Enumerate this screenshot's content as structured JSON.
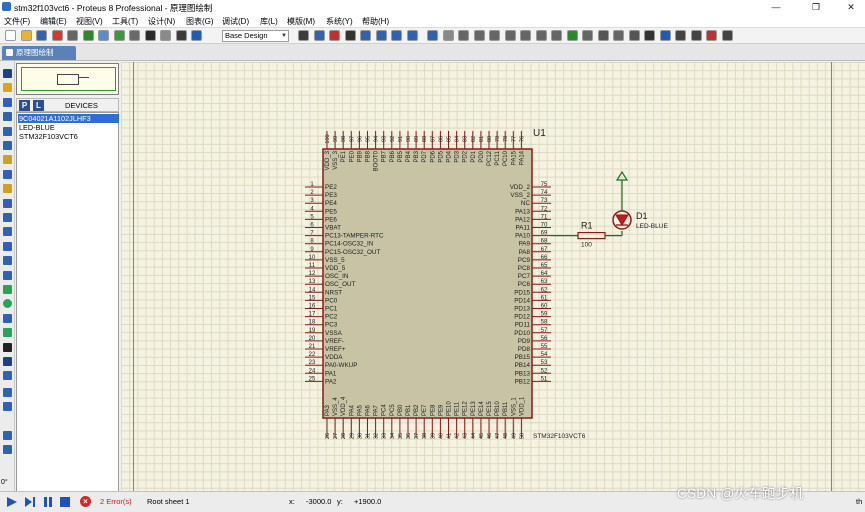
{
  "window": {
    "title": "stm32f103vct6 - Proteus 8 Professional - 原理图绘制",
    "minimize": "—",
    "maximize": "❐",
    "close": "✕"
  },
  "menu": [
    "文件(F)",
    "编辑(E)",
    "视图(V)",
    "工具(T)",
    "设计(N)",
    "图表(G)",
    "调试(D)",
    "库(L)",
    "模版(M)",
    "系统(Y)",
    "帮助(H)"
  ],
  "toolbar": {
    "design_select": "Base Design",
    "icons": [
      "new-icon",
      "open-icon",
      "save-icon",
      "import-icon",
      "close-icon",
      "home-icon",
      "schematic-icon",
      "pcb-icon",
      "gallery-icon",
      "bom-icon",
      "source-icon",
      "vsm-icon",
      "help-icon",
      "refresh-icon",
      "grid-icon",
      "origin-icon",
      "pan-icon",
      "zoom-in-icon",
      "zoom-out-icon",
      "zoom-all-icon",
      "zoom-area-icon",
      "undo-icon",
      "redo-icon",
      "cut-icon",
      "copy-icon",
      "paste-icon",
      "block-copy-icon",
      "block-move-icon",
      "block-rotate-icon",
      "block-delete-icon",
      "pick-device-icon",
      "make-device-icon",
      "packaging-icon",
      "decompose-icon",
      "wire-autorouter-icon",
      "search-icon",
      "property-tool-icon",
      "new-sheet-icon",
      "remove-sheet-icon",
      "exit-to-parent-icon",
      "annotate-icon"
    ]
  },
  "tab": {
    "label": "原理图绘制"
  },
  "side_tools": [
    "select-icon",
    "component-icon",
    "junction-icon",
    "wire-label-icon",
    "text-script-icon",
    "bus-icon",
    "subcircuit-icon",
    "terminal-icon",
    "device-pin-icon",
    "graph-icon",
    "recorder-icon",
    "generator-icon",
    "probe-icon",
    "instrument-icon",
    "line-icon",
    "box-icon",
    "circle-icon",
    "arc-icon",
    "path-icon",
    "text-icon",
    "symbol-icon",
    "marker-icon",
    "rotate-cw-icon",
    "rotate-ccw-icon",
    "flip-h-icon",
    "flip-v-icon"
  ],
  "rotation": "0°",
  "devices": {
    "p_button": "P",
    "l_button": "L",
    "header": "DEVICES",
    "items": [
      "9C04021A1102JLHF3",
      "LED-BLUE",
      "STM32F103VCT6"
    ],
    "selected_index": 0
  },
  "schematic": {
    "chip_ref": "U1",
    "chip_part": "STM32F103VCT6",
    "left_pins": [
      {
        "num": "1",
        "name": "PE2"
      },
      {
        "num": "2",
        "name": "PE3"
      },
      {
        "num": "3",
        "name": "PE4"
      },
      {
        "num": "4",
        "name": "PE5"
      },
      {
        "num": "5",
        "name": "PE6"
      },
      {
        "num": "6",
        "name": "VBAT"
      },
      {
        "num": "7",
        "name": "PC13-TAMPER-RTC"
      },
      {
        "num": "8",
        "name": "PC14-OSC32_IN"
      },
      {
        "num": "9",
        "name": "PC15-OSC32_OUT"
      },
      {
        "num": "10",
        "name": "VSS_5"
      },
      {
        "num": "11",
        "name": "VDD_5"
      },
      {
        "num": "12",
        "name": "OSC_IN"
      },
      {
        "num": "13",
        "name": "OSC_OUT"
      },
      {
        "num": "14",
        "name": "NRST"
      },
      {
        "num": "15",
        "name": "PC0"
      },
      {
        "num": "16",
        "name": "PC1"
      },
      {
        "num": "17",
        "name": "PC2"
      },
      {
        "num": "18",
        "name": "PC3"
      },
      {
        "num": "19",
        "name": "VSSA"
      },
      {
        "num": "20",
        "name": "VREF-"
      },
      {
        "num": "21",
        "name": "VREF+"
      },
      {
        "num": "22",
        "name": "VDDA"
      },
      {
        "num": "23",
        "name": "PA0-WKUP"
      },
      {
        "num": "24",
        "name": "PA1"
      },
      {
        "num": "25",
        "name": "PA2"
      }
    ],
    "right_pins": [
      {
        "num": "75",
        "name": "VDD_2"
      },
      {
        "num": "74",
        "name": "VSS_2"
      },
      {
        "num": "73",
        "name": "NC"
      },
      {
        "num": "72",
        "name": "PA13"
      },
      {
        "num": "71",
        "name": "PA12"
      },
      {
        "num": "70",
        "name": "PA11"
      },
      {
        "num": "69",
        "name": "PA10"
      },
      {
        "num": "68",
        "name": "PA9"
      },
      {
        "num": "67",
        "name": "PA8"
      },
      {
        "num": "66",
        "name": "PC9"
      },
      {
        "num": "65",
        "name": "PC8"
      },
      {
        "num": "64",
        "name": "PC7"
      },
      {
        "num": "63",
        "name": "PC6"
      },
      {
        "num": "62",
        "name": "PD15"
      },
      {
        "num": "61",
        "name": "PD14"
      },
      {
        "num": "60",
        "name": "PD13"
      },
      {
        "num": "59",
        "name": "PD12"
      },
      {
        "num": "58",
        "name": "PD11"
      },
      {
        "num": "57",
        "name": "PD10"
      },
      {
        "num": "56",
        "name": "PD9"
      },
      {
        "num": "55",
        "name": "PD8"
      },
      {
        "num": "54",
        "name": "PB15"
      },
      {
        "num": "53",
        "name": "PB14"
      },
      {
        "num": "52",
        "name": "PB13"
      },
      {
        "num": "51",
        "name": "PB12"
      }
    ],
    "top_pins": [
      {
        "num": "100",
        "name": "VDD_3"
      },
      {
        "num": "99",
        "name": "VSS_3"
      },
      {
        "num": "98",
        "name": "PE1"
      },
      {
        "num": "97",
        "name": "PE0"
      },
      {
        "num": "96",
        "name": "PB9"
      },
      {
        "num": "95",
        "name": "PB8"
      },
      {
        "num": "94",
        "name": "BOOT0"
      },
      {
        "num": "93",
        "name": "PB7"
      },
      {
        "num": "92",
        "name": "PB6"
      },
      {
        "num": "91",
        "name": "PB5"
      },
      {
        "num": "90",
        "name": "PB4"
      },
      {
        "num": "89",
        "name": "PB3"
      },
      {
        "num": "88",
        "name": "PD7"
      },
      {
        "num": "87",
        "name": "PD6"
      },
      {
        "num": "86",
        "name": "PD5"
      },
      {
        "num": "85",
        "name": "PD4"
      },
      {
        "num": "84",
        "name": "PD3"
      },
      {
        "num": "83",
        "name": "PD2"
      },
      {
        "num": "82",
        "name": "PD1"
      },
      {
        "num": "81",
        "name": "PD0"
      },
      {
        "num": "80",
        "name": "PC12"
      },
      {
        "num": "79",
        "name": "PC11"
      },
      {
        "num": "78",
        "name": "PC10"
      },
      {
        "num": "77",
        "name": "PA15"
      },
      {
        "num": "76",
        "name": "PA14"
      }
    ],
    "bottom_pins": [
      {
        "num": "26",
        "name": "PA3"
      },
      {
        "num": "27",
        "name": "VSS_4"
      },
      {
        "num": "28",
        "name": "VDD_4"
      },
      {
        "num": "29",
        "name": "PA4"
      },
      {
        "num": "30",
        "name": "PA5"
      },
      {
        "num": "31",
        "name": "PA6"
      },
      {
        "num": "32",
        "name": "PA7"
      },
      {
        "num": "33",
        "name": "PC4"
      },
      {
        "num": "34",
        "name": "PC5"
      },
      {
        "num": "35",
        "name": "PB0"
      },
      {
        "num": "36",
        "name": "PB1"
      },
      {
        "num": "37",
        "name": "PB2"
      },
      {
        "num": "38",
        "name": "PE7"
      },
      {
        "num": "39",
        "name": "PE8"
      },
      {
        "num": "40",
        "name": "PE9"
      },
      {
        "num": "41",
        "name": "PE10"
      },
      {
        "num": "42",
        "name": "PE11"
      },
      {
        "num": "43",
        "name": "PE12"
      },
      {
        "num": "44",
        "name": "PE13"
      },
      {
        "num": "45",
        "name": "PE14"
      },
      {
        "num": "46",
        "name": "PE15"
      },
      {
        "num": "47",
        "name": "PB10"
      },
      {
        "num": "48",
        "name": "PB11"
      },
      {
        "num": "49",
        "name": "VSS_1"
      },
      {
        "num": "50",
        "name": "VDD_1"
      }
    ],
    "resistor": {
      "ref": "R1",
      "value": "100"
    },
    "led": {
      "ref": "D1",
      "part": "LED-BLUE"
    },
    "colors": {
      "chip_fill": "#c7c3a4",
      "chip_border": "#8b1a1a",
      "pin": "#8b1a1a",
      "wire": "#1f6e1f",
      "led": "#c21a1a",
      "text": "#1d1d1d"
    }
  },
  "status": {
    "errors": "2 Error(s)",
    "sheet": "Root sheet 1",
    "x_label": "x:",
    "x_value": "-3000.0",
    "y_label": "y:",
    "y_value": "+1900.0",
    "trailing": "th"
  },
  "watermark": "CSDN @火车跑步机"
}
